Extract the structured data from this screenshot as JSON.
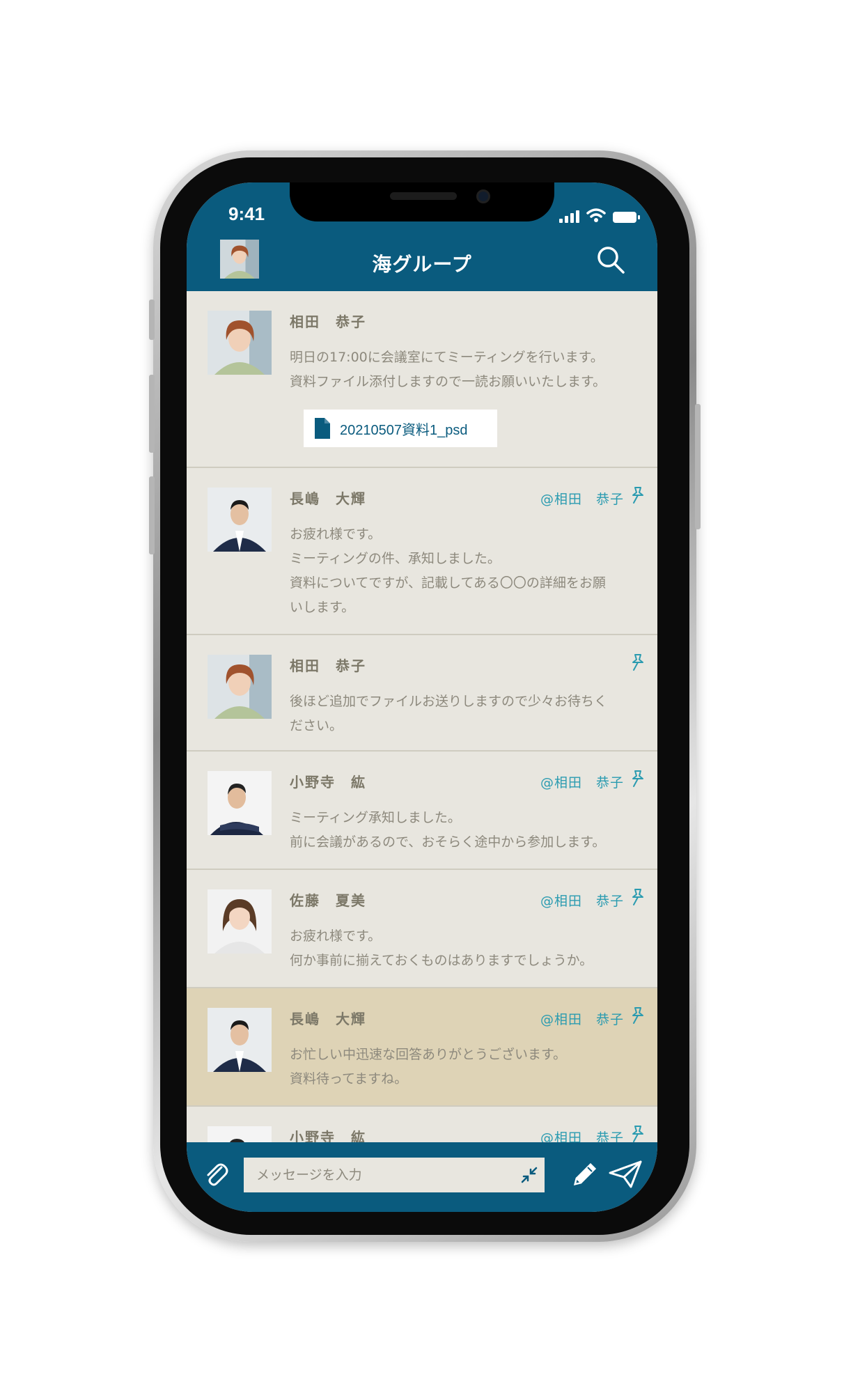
{
  "status_bar": {
    "time": "9:41"
  },
  "header": {
    "title": "海グループ"
  },
  "messages": [
    {
      "sender": "相田　恭子",
      "avatar": "woman-short-hair",
      "mention": "",
      "lines": [
        "明日の17:00に会議室にてミーティングを行います。",
        "資料ファイル添付しますので一読お願いいたします。"
      ],
      "attachment": "20210507資料1_psd"
    },
    {
      "sender": "長嶋　大輝",
      "avatar": "man-suit",
      "mention": "@相田　恭子",
      "lines": [
        "お疲れ様です。",
        "ミーティングの件、承知しました。",
        "資料についてですが、記載してある〇〇の詳細をお願",
        "いします。"
      ]
    },
    {
      "sender": "相田　恭子",
      "avatar": "woman-short-hair",
      "mention": "",
      "lines": [
        "後ほど追加でファイルお送りしますので少々お待ちく",
        "ださい。"
      ]
    },
    {
      "sender": "小野寺　紘",
      "avatar": "man-arms-crossed",
      "mention": "@相田　恭子",
      "lines": [
        "ミーティング承知しました。",
        "前に会議があるので、おそらく途中から参加します。"
      ]
    },
    {
      "sender": "佐藤　夏美",
      "avatar": "woman-long-hair",
      "mention": "@相田　恭子",
      "lines": [
        "お疲れ様です。",
        "何か事前に揃えておくものはありますでしょうか。"
      ]
    },
    {
      "sender": "長嶋　大輝",
      "avatar": "man-suit",
      "mention": "@相田　恭子",
      "lines": [
        "お忙しい中迅速な回答ありがとうございます。",
        "資料待ってますね。"
      ],
      "highlighted": true
    },
    {
      "sender": "小野寺　紘",
      "avatar": "man-arms-crossed",
      "mention": "@相田　恭子",
      "lines": []
    }
  ],
  "composer": {
    "placeholder": "メッセージを入力"
  },
  "icons": [
    "search-icon",
    "pin-icon",
    "file-icon",
    "paperclip-icon",
    "shrink-icon",
    "pencil-icon",
    "send-icon"
  ],
  "colors": {
    "primary": "#0a5b7e",
    "background": "#e8e6df",
    "highlight": "#ded3b6",
    "mention": "#2a9bb0"
  }
}
